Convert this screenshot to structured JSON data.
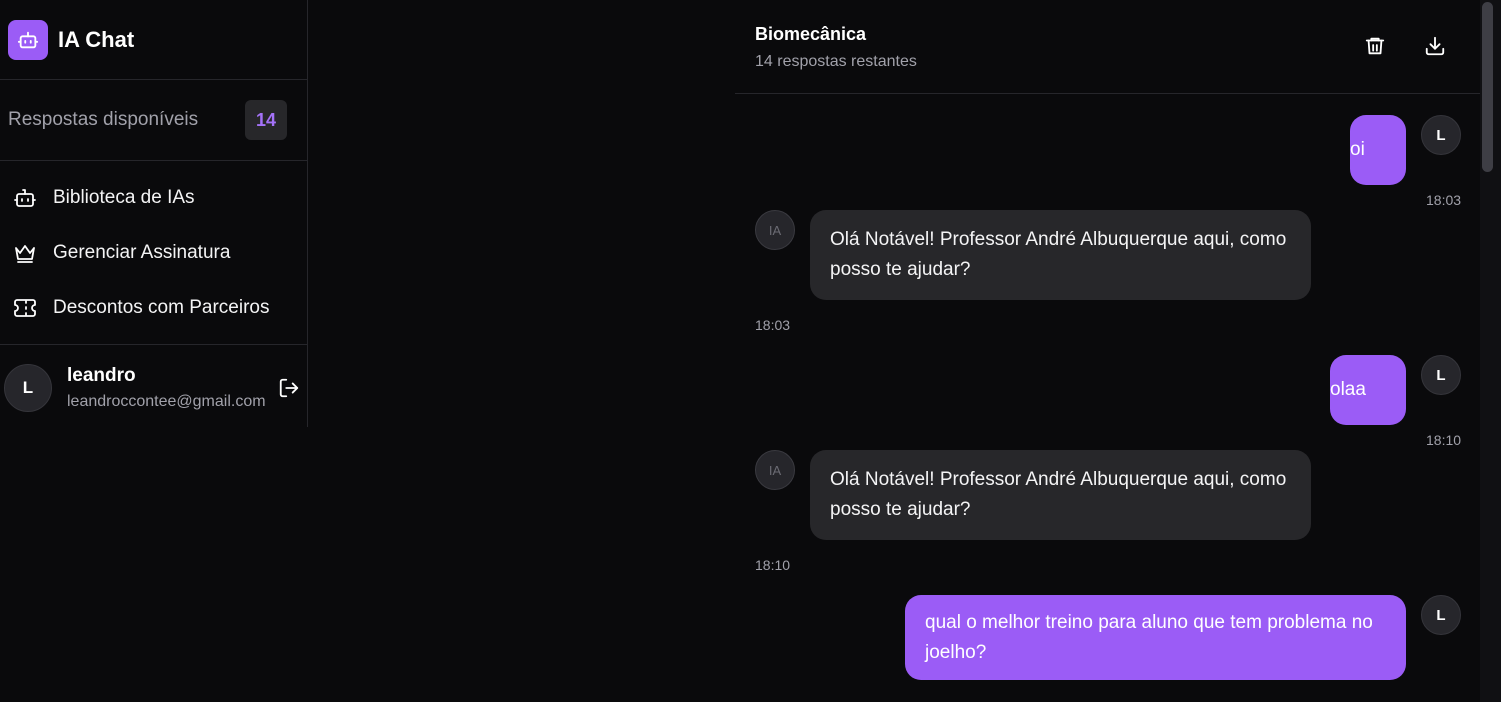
{
  "sidebar": {
    "app_title": "IA Chat",
    "credits": {
      "label": "Respostas disponíveis",
      "count": "14"
    },
    "nav": [
      {
        "label": "Biblioteca de IAs",
        "icon": "bot-icon"
      },
      {
        "label": "Gerenciar Assinatura",
        "icon": "crown-icon"
      },
      {
        "label": "Descontos com Parceiros",
        "icon": "ticket-icon"
      }
    ],
    "user": {
      "initial": "L",
      "name": "leandro",
      "email": "leandroccontee@gmail.com"
    }
  },
  "chat": {
    "title": "Biomecânica",
    "subtitle": "14 respostas restantes",
    "messages": [
      {
        "role": "user",
        "text": "oi",
        "time": "18:03",
        "avatar": "L"
      },
      {
        "role": "ai",
        "text": "Olá Notável! Professor André Albuquerque aqui, como posso te ajudar?",
        "time": "18:03",
        "avatar": "IA"
      },
      {
        "role": "user",
        "text": "olaa",
        "time": "18:10",
        "avatar": "L"
      },
      {
        "role": "ai",
        "text": "Olá Notável! Professor André Albuquerque aqui, como posso te ajudar?",
        "time": "18:10",
        "avatar": "IA"
      },
      {
        "role": "user",
        "text": "qual o melhor treino para aluno que tem problema no joelho?",
        "avatar": "L"
      }
    ]
  },
  "colors": {
    "accent": "#9b5cf6",
    "background": "#0a0a0c",
    "ai_bubble": "#27272a"
  }
}
